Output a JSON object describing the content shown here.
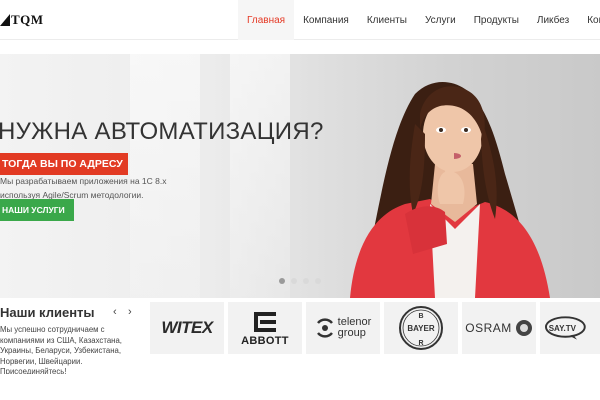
{
  "header": {
    "logo_text": "TQM",
    "nav": [
      {
        "label": "Главная",
        "active": true
      },
      {
        "label": "Компания",
        "active": false
      },
      {
        "label": "Клиенты",
        "active": false
      },
      {
        "label": "Услуги",
        "active": false
      },
      {
        "label": "Продукты",
        "active": false
      },
      {
        "label": "Ликбез",
        "active": false
      },
      {
        "label": "Контакты",
        "active": false
      }
    ]
  },
  "hero": {
    "title": "НУЖНА АВТОМАТИЗАЦИЯ?",
    "badge": "ТОГДА ВЫ ПО АДРЕСУ",
    "line1": "Мы разрабатываем приложения на 1С 8.х",
    "line2": "используя Agile/Scrum методологии.",
    "button": "НАШИ УСЛУГИ",
    "slides": 4,
    "active_slide": 1
  },
  "clients": {
    "title": "Наши клиенты",
    "prev_icon": "chevron-left-icon",
    "next_icon": "chevron-right-icon",
    "text": "Мы успешно сотрудничаем с компаниями из США, Казахстана, Украины, Беларуси, Узбекистана, Норвегии, Швейцарии. Присоединяйтесь!",
    "logos": [
      {
        "name": "WITEX",
        "icon": "witex-logo"
      },
      {
        "name": "ABBOTT",
        "icon": "abbott-logo"
      },
      {
        "name": "telenor group",
        "line1": "telenor",
        "line2": "group",
        "icon": "telenor-logo"
      },
      {
        "name": "BAYER",
        "icon": "bayer-logo"
      },
      {
        "name": "OSRAM",
        "icon": "osram-logo"
      },
      {
        "name": "SAY.TV",
        "icon": "saytv-logo"
      }
    ]
  },
  "colors": {
    "accent_red": "#e23a23",
    "button_green": "#3aa84a",
    "nav_active": "#e53a26"
  }
}
